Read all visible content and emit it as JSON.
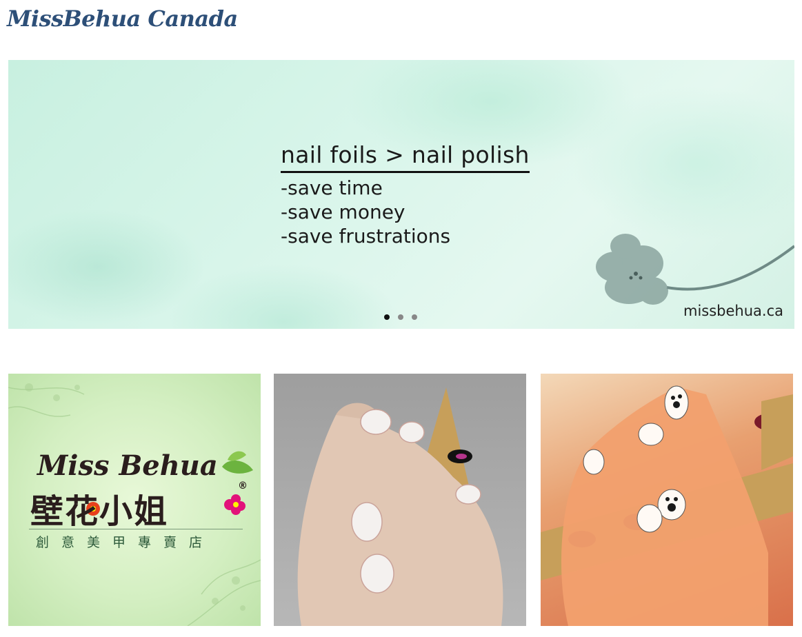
{
  "header": {
    "site_title": "MissBehua Canada"
  },
  "hero": {
    "headline": "nail foils > nail polish",
    "lines": [
      "-save time",
      "-save money",
      "-save frustrations"
    ],
    "domain": "missbehua.ca",
    "slide_count": 3,
    "active_slide": 1
  },
  "tiles": {
    "logo": {
      "script": "Miss Behua",
      "chinese_name": "壁花小姐",
      "registered_mark": "®",
      "subtitle": "創意美甲專賣店"
    }
  },
  "colors": {
    "title": "#2d4f78",
    "hero_bg": "#d8f5ea"
  }
}
